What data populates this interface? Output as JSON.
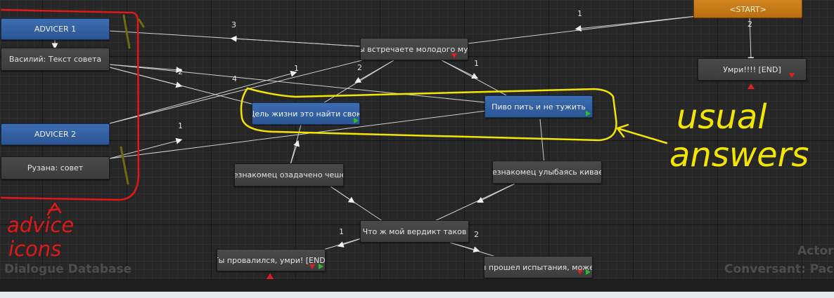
{
  "nodes": {
    "start": "<START>",
    "advicer1": "ADVICER 1",
    "vasily": "Василий: Текст совета",
    "advicer2": "ADVICER 2",
    "ruzana": "Рузана: совет",
    "meet": "Вы встречаете молодого муж",
    "goal": "Цель жизни это найти свою",
    "beer": "Пиво пить и не тужить",
    "scratch": "Незнакомец озадачено чешет",
    "nods": "Незнакомец улыбаясь кивает",
    "verdict": "Что ж мой вердикт таков",
    "failed": "Ты провалился, умри! [END]",
    "passed": "Ты прошел испытания, можеш",
    "die": "Умри!!!! [END]"
  },
  "link_labels": {
    "l_start_meet": "1",
    "l_start_die": "2",
    "l_meet_advicer1": "3",
    "l_vasily_beer": "2",
    "l_vasily_goal": "4",
    "l_advicer2_meet": "1",
    "l_meet_goal": "2",
    "l_meet_beer": "1",
    "l_ruzana_beer": "1",
    "l_verdict_failed": "1",
    "l_verdict_passed": "2"
  },
  "watermarks": {
    "database": "Dialogue Database",
    "actor": "Actor",
    "conversant": "Conversant: Pac"
  },
  "annotations": {
    "advice_line1": "advice",
    "advice_line2": "icons",
    "usual_line1": "usual",
    "usual_line2": "answers"
  },
  "colors": {
    "node_gray": "#444444",
    "node_blue": "#3462a6",
    "node_start": "#c97b18",
    "annotation_red": "#e01818",
    "annotation_yellow": "#f2e600"
  }
}
